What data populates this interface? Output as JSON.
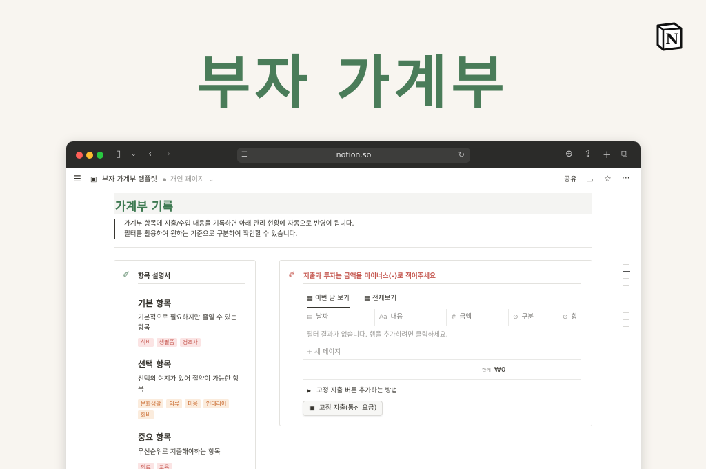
{
  "hero": {
    "title": "부자 가계부"
  },
  "logo": {
    "letter": "N"
  },
  "browser": {
    "url": "notion.so",
    "colors": {
      "titlebar": "#2b2b29",
      "url_bg": "#3d3d3b"
    }
  },
  "notion_top": {
    "page_icon": "money-icon",
    "page_name": "부자 가계부 템플릿",
    "visibility": "개인 페이지",
    "share": "공유"
  },
  "page": {
    "title": "가계부 기록",
    "quote_lines": [
      "가계부 항목에 지출/수입 내용을 기록하면 아래 관리 현황에 자동으로 반영이 됩니다.",
      "필터를 활용하여 원하는 기준으로 구분하여 확인할 수 있습니다."
    ]
  },
  "guide": {
    "heading": "항목 설명서",
    "sections": [
      {
        "title": "기본 항목",
        "desc": "기본적으로 필요하지만 줄일 수 있는 항목",
        "tags": [
          "식비",
          "생필품",
          "경조사"
        ],
        "tag_color": "red"
      },
      {
        "title": "선택 항목",
        "desc": "선택의 여지가 있어 절약이 가능한 항목",
        "tags": [
          "문화생활",
          "의류",
          "미용",
          "인테리어",
          "회비"
        ],
        "tag_color": "orange"
      },
      {
        "title": "중요 항목",
        "desc": "우선순위로 지출해야하는 항목",
        "tags": [
          "의료",
          "교육"
        ],
        "tag_color": "red"
      }
    ]
  },
  "ledger": {
    "heading": "지출과 투자는 금액을 마이너스(-)로 적어주세요",
    "tabs": [
      "이번 달 보기",
      "전체보기"
    ],
    "columns": [
      {
        "icon": "calendar-icon",
        "label": "날짜"
      },
      {
        "icon": "text-icon",
        "label": "내용",
        "prefix": "Aa"
      },
      {
        "icon": "number-icon",
        "label": "금액",
        "prefix": "#"
      },
      {
        "icon": "select-icon",
        "label": "구분"
      },
      {
        "icon": "select-icon",
        "label": "항"
      }
    ],
    "empty_text": "필터 결과가 없습니다. 행을 추가하려면 클릭하세요.",
    "new_page": "새 페이지",
    "sum_label": "합계",
    "sum_value": "₩0",
    "toggle_label": "고정 지출 버튼 추가하는 방법",
    "button_label": "고정 지출(통신 요금)"
  },
  "colors": {
    "accent": "#4a7c59",
    "warning": "#c4554d"
  }
}
